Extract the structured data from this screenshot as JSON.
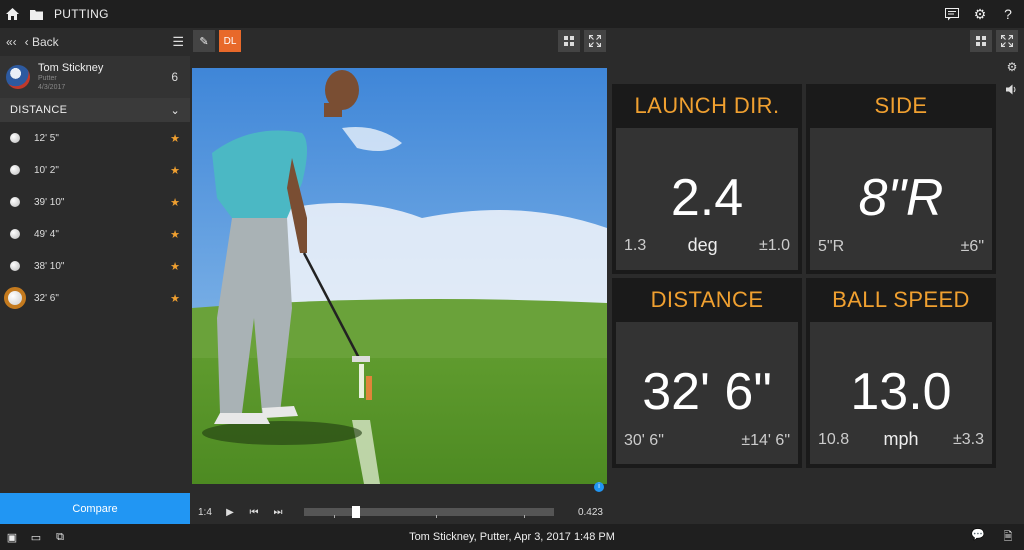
{
  "app": {
    "title": "PUTTING"
  },
  "topbar": {
    "icons": [
      "home-icon",
      "folder-icon",
      "chat-icon",
      "gear-icon",
      "help-icon"
    ],
    "help_label": "?"
  },
  "sidebar": {
    "collapse_label": "«‹",
    "back_label": "‹ Back",
    "user": {
      "name": "Tom Stickney",
      "club": "Putter",
      "date": "4/3/2017",
      "count": "6"
    },
    "section": "DISTANCE",
    "shots": [
      {
        "label": "12' 5\"",
        "selected": false
      },
      {
        "label": "10' 2\"",
        "selected": false
      },
      {
        "label": "39' 10\"",
        "selected": false
      },
      {
        "label": "49' 4\"",
        "selected": false
      },
      {
        "label": "38' 10\"",
        "selected": false
      },
      {
        "label": "32' 6\"",
        "selected": true
      }
    ],
    "compare_label": "Compare"
  },
  "video_toolbar": {
    "draw_label": "✎",
    "dl_label": "DL"
  },
  "playback": {
    "rate": "1:4",
    "position": 0.2,
    "time": "0.423"
  },
  "metrics": [
    {
      "title": "LAUNCH DIR.",
      "value": "2.4",
      "left": "1.3",
      "unit": "deg",
      "right": "±1.0"
    },
    {
      "title": "SIDE",
      "value": "8\"R",
      "left": "5\"R",
      "unit": "",
      "right": "±6\""
    },
    {
      "title": "DISTANCE",
      "value": "32' 6\"",
      "left": "30' 6\"",
      "unit": "",
      "right": "±14' 6\""
    },
    {
      "title": "BALL SPEED",
      "value": "13.0",
      "left": "10.8",
      "unit": "mph",
      "right": "±3.3"
    }
  ],
  "status": {
    "caption": "Tom Stickney, Putter, Apr 3, 2017 1:48 PM"
  },
  "colors": {
    "accent": "#f0a030",
    "dl": "#e8692a",
    "compare": "#2196f3"
  }
}
